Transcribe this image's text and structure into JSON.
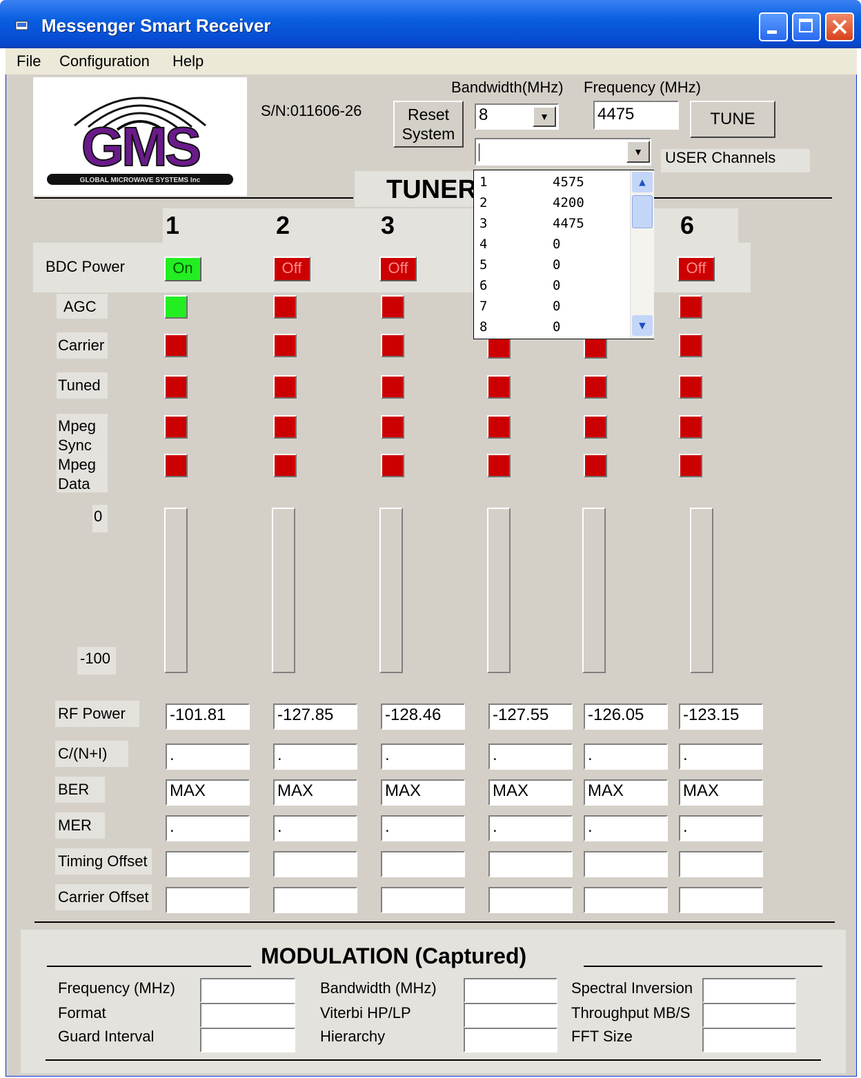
{
  "window": {
    "title": "Messenger Smart Receiver"
  },
  "menu": [
    "File",
    "Configuration",
    "Help"
  ],
  "header": {
    "serial": "S/N:011606-26",
    "reset_button": [
      "Reset",
      "System"
    ],
    "bandwidth_label": "Bandwidth(MHz)",
    "bandwidth_value": "8",
    "frequency_label": "Frequency (MHz)",
    "frequency_value": "4475",
    "tune_button": "TUNE",
    "user_channels_label": "USER Channels",
    "user_channels_value": ""
  },
  "logo": {
    "text": "GMS",
    "subtext": "GLOBAL MICROWAVE SYSTEMS Inc"
  },
  "tuner": {
    "section_title": "TUNER",
    "columns": [
      "1",
      "2",
      "3",
      "6"
    ],
    "bdc_power_label": "BDC Power",
    "bdc_power": [
      "On",
      "Off",
      "Off",
      "Off"
    ],
    "indicator_labels": [
      "AGC",
      "Carrier",
      "Tuned",
      "Mpeg Sync",
      "Mpeg Data"
    ],
    "meter_top": "0",
    "meter_bottom": "-100",
    "rows": {
      "rf_power": {
        "label": "RF Power",
        "values": [
          "-101.81",
          "-127.85",
          "-128.46",
          "-127.55",
          "-126.05",
          "-123.15"
        ]
      },
      "cn": {
        "label": "C/(N+I)",
        "values": [
          ".",
          ".",
          ".",
          ".",
          ".",
          "."
        ]
      },
      "ber": {
        "label": "BER",
        "values": [
          "MAX",
          "MAX",
          "MAX",
          "MAX",
          "MAX",
          "MAX"
        ]
      },
      "mer": {
        "label": "MER",
        "values": [
          ".",
          ".",
          ".",
          ".",
          ".",
          "."
        ]
      },
      "timing_offset": {
        "label": "Timing Offset",
        "values": [
          "",
          "",
          "",
          "",
          "",
          ""
        ]
      },
      "carrier_offset": {
        "label": "Carrier Offset",
        "values": [
          "",
          "",
          "",
          "",
          "",
          ""
        ]
      }
    }
  },
  "channels_dropdown": [
    {
      "n": "1",
      "freq": "4575"
    },
    {
      "n": "2",
      "freq": "4200"
    },
    {
      "n": "3",
      "freq": "4475"
    },
    {
      "n": "4",
      "freq": "0"
    },
    {
      "n": "5",
      "freq": "0"
    },
    {
      "n": "6",
      "freq": "0"
    },
    {
      "n": "7",
      "freq": "0"
    },
    {
      "n": "8",
      "freq": "0"
    }
  ],
  "modulation": {
    "title": "MODULATION (Captured)",
    "fields": {
      "frequency": "Frequency (MHz)",
      "format": "Format",
      "guard_interval": "Guard Interval",
      "bandwidth": "Bandwidth (MHz)",
      "viterbi": "Viterbi HP/LP",
      "hierarchy": "Hierarchy",
      "spectral_inversion": "Spectral Inversion",
      "throughput": "Throughput MB/S",
      "fft_size": "FFT Size"
    }
  },
  "colors": {
    "led_on": "#22ee22",
    "led_off": "#cc0000",
    "logo_purple": "#6a1a8a",
    "titlebar": "#0a5fe0"
  }
}
